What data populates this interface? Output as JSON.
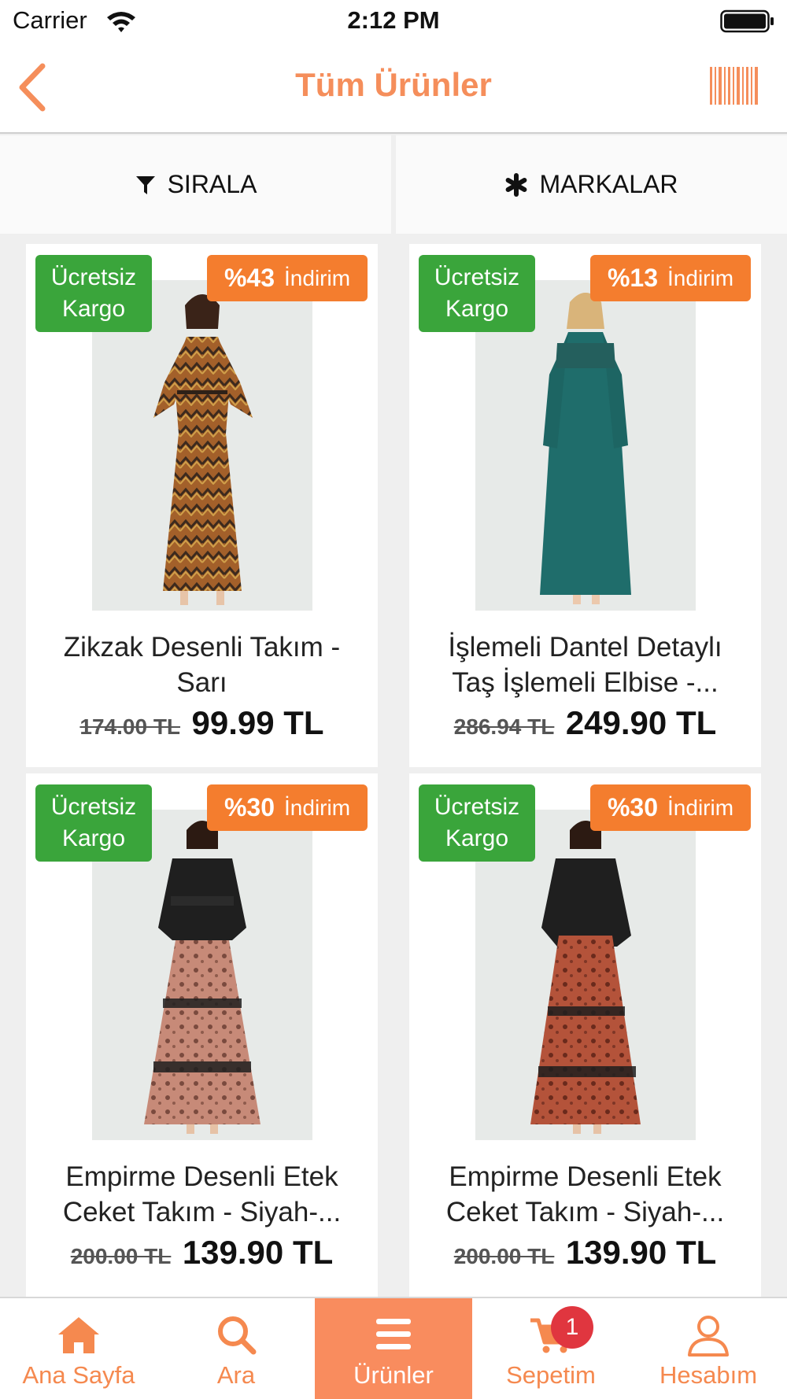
{
  "status_bar": {
    "carrier": "Carrier",
    "time": "2:12 PM"
  },
  "nav": {
    "title": "Tüm Ürünler",
    "back_icon": "chevron-left-icon",
    "barcode_icon": "barcode-icon"
  },
  "filters": {
    "sort_label": "SIRALA",
    "brands_label": "MARKALAR"
  },
  "products": [
    {
      "name_line1": "Zikzak Desenli Takım -",
      "name_line2": "Sarı",
      "old_price": "174.00 TL",
      "new_price": "99.99 TL",
      "discount_pct": "%43",
      "discount_word": "İndirim",
      "cargo_line1": "Ücretsiz",
      "cargo_line2": "Kargo"
    },
    {
      "name_line1": "İşlemeli Dantel Detaylı",
      "name_line2": "Taş İşlemeli Elbise -...",
      "old_price": "286.94 TL",
      "new_price": "249.90 TL",
      "discount_pct": "%13",
      "discount_word": "İndirim",
      "cargo_line1": "Ücretsiz",
      "cargo_line2": "Kargo"
    },
    {
      "name_line1": "Empirme Desenli Etek",
      "name_line2": "Ceket Takım - Siyah-...",
      "old_price": "200.00 TL",
      "new_price": "139.90 TL",
      "discount_pct": "%30",
      "discount_word": "İndirim",
      "cargo_line1": "Ücretsiz",
      "cargo_line2": "Kargo"
    },
    {
      "name_line1": "Empirme Desenli Etek",
      "name_line2": "Ceket Takım - Siyah-...",
      "old_price": "200.00 TL",
      "new_price": "139.90 TL",
      "discount_pct": "%30",
      "discount_word": "İndirim",
      "cargo_line1": "Ücretsiz",
      "cargo_line2": "Kargo"
    }
  ],
  "tabs": [
    {
      "label": "Ana Sayfa",
      "icon": "home-icon"
    },
    {
      "label": "Ara",
      "icon": "search-icon"
    },
    {
      "label": "Ürünler",
      "icon": "menu-icon",
      "active": true
    },
    {
      "label": "Sepetim",
      "icon": "cart-icon",
      "badge": "1"
    },
    {
      "label": "Hesabım",
      "icon": "user-icon"
    }
  ],
  "colors": {
    "accent": "#f58e5b",
    "cargo_green": "#3aa53b",
    "discount_orange": "#f47d2e",
    "cart_badge": "#e0363f"
  }
}
